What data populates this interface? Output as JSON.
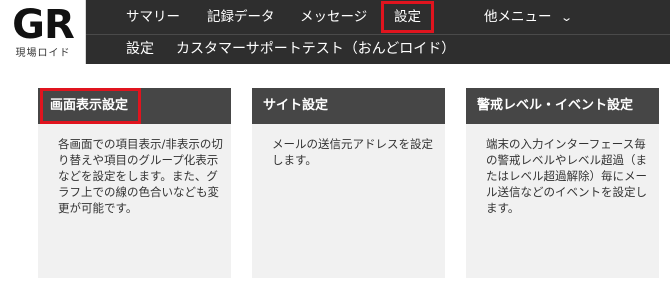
{
  "brand": {
    "mark": "GR",
    "subtitle": "現場ロイド"
  },
  "nav": {
    "items": [
      {
        "label": "サマリー"
      },
      {
        "label": "記録データ"
      },
      {
        "label": "メッセージ"
      },
      {
        "label": "設定",
        "active": true
      },
      {
        "label": "他メニュー",
        "dropdown": true
      }
    ],
    "chevron_icon": "chevron-down-icon"
  },
  "subbar": {
    "section": "設定",
    "title": "カスタマーサポートテスト（おんどロイド）"
  },
  "cards": [
    {
      "title": "画面表示設定",
      "description": "各画面での項目表示/非表示の切り替えや項目のグループ化表示などを設定をします。また、グラフ上での線の色合いなども変更が可能です。"
    },
    {
      "title": "サイト設定",
      "description": "メールの送信元アドレスを設定します。"
    },
    {
      "title": "警戒レベル・イベント設定",
      "description": "端末の入力インターフェース毎の警戒レベルやレベル超過（またはレベル超過解除）毎にメール送信などのイベントを設定します。"
    }
  ],
  "colors": {
    "bar": "#2e2e2e",
    "card_head": "#464646",
    "card_bg": "#f1f1f1",
    "highlight": "#e0141e"
  }
}
